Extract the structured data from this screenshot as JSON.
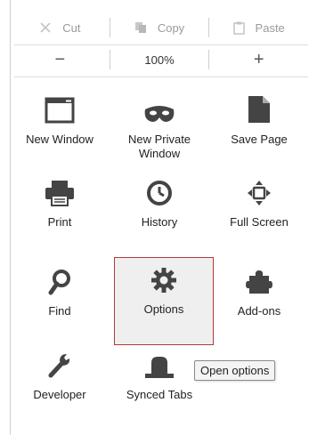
{
  "edit": {
    "cut_label": "Cut",
    "copy_label": "Copy",
    "paste_label": "Paste"
  },
  "zoom": {
    "out_label": "−",
    "level": "100%",
    "in_label": "+"
  },
  "tiles": [
    {
      "label": "New Window",
      "icon": "window-icon"
    },
    {
      "label": "New Private Window",
      "icon": "mask-icon"
    },
    {
      "label": "Save Page",
      "icon": "page-icon"
    },
    {
      "label": "Print",
      "icon": "printer-icon"
    },
    {
      "label": "History",
      "icon": "clock-icon"
    },
    {
      "label": "Full Screen",
      "icon": "fullscreen-icon"
    },
    {
      "label": "Find",
      "icon": "magnifier-icon"
    },
    {
      "label": "Options",
      "icon": "gear-icon"
    },
    {
      "label": "Add-ons",
      "icon": "puzzle-icon"
    },
    {
      "label": "Developer",
      "icon": "wrench-icon"
    },
    {
      "label": "Synced Tabs",
      "icon": "synced-tabs-icon"
    }
  ],
  "tooltip": "Open options",
  "colors": {
    "selected_border": "#b13a3a",
    "selected_bg": "#efefef",
    "icon_dark": "#444444",
    "disabled_text": "#9a9a9a"
  }
}
